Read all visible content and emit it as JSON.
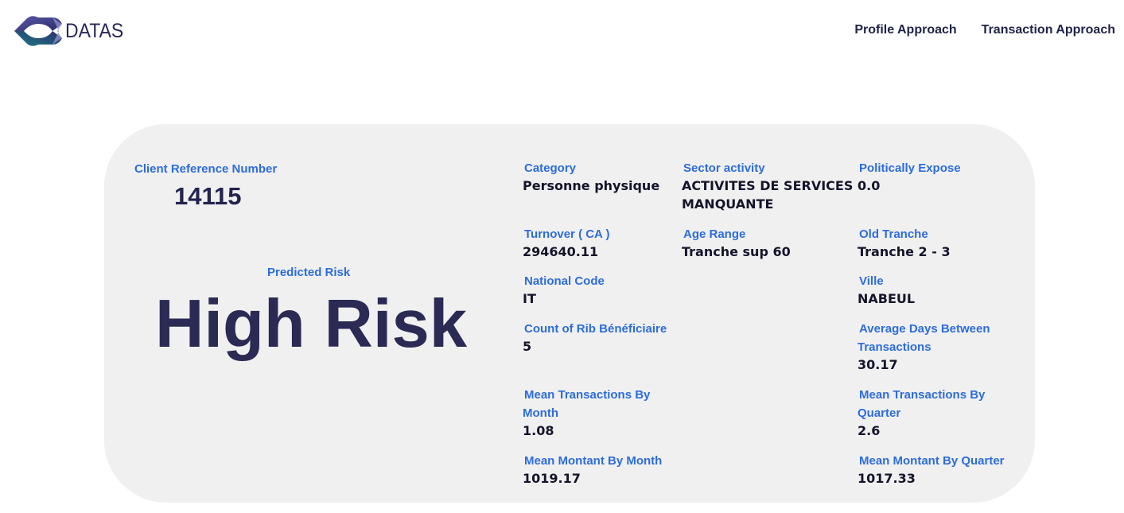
{
  "header": {
    "logo_text": "DATAS",
    "nav": [
      {
        "label": "Profile Approach"
      },
      {
        "label": "Transaction Approach"
      }
    ]
  },
  "client": {
    "reference_label": "Client Reference Number",
    "reference_value": "14115",
    "predicted_label": "Predicted Risk",
    "predicted_value": "High Risk"
  },
  "fields": {
    "category": {
      "label": "Category",
      "value": "Personne physique"
    },
    "sector": {
      "label": "Sector activity",
      "value_line1": "ACTIVITES DE SERVICES",
      "value_line2": "MANQUANTE"
    },
    "politically": {
      "label": "Politically Expose",
      "value": "0.0"
    },
    "turnover": {
      "label": "Turnover ( CA )",
      "value": "294640.11"
    },
    "age": {
      "label": "Age Range",
      "value": "Tranche sup 60"
    },
    "old_tranche": {
      "label": "Old Tranche",
      "value": "Tranche 2 - 3"
    },
    "national": {
      "label": "National Code",
      "value": "IT"
    },
    "ville": {
      "label": "Ville",
      "value": "NABEUL"
    },
    "count_rib": {
      "label": "Count of Rib Bénéficiaire",
      "value": "5"
    },
    "avg_days": {
      "label_line1": "Average Days Between",
      "label_line2": "Transactions",
      "value": "30.17"
    },
    "mean_tx_month": {
      "label_line1": "Mean Transactions By",
      "label_line2": "Month",
      "value": "1.08"
    },
    "mean_tx_quarter": {
      "label_line1": "Mean Transactions By",
      "label_line2": "Quarter",
      "value": "2.6"
    },
    "mean_montant_month": {
      "label": "Mean Montant By Month",
      "value": "1019.17"
    },
    "mean_montant_quarter": {
      "label": "Mean Montant By Quarter",
      "value": "1017.33"
    }
  },
  "colors": {
    "label_blue": "#2d6cdc",
    "value_dark": "#14142b",
    "risk_navy": "#2a2a55",
    "card_bg": "#f0f0f0"
  }
}
